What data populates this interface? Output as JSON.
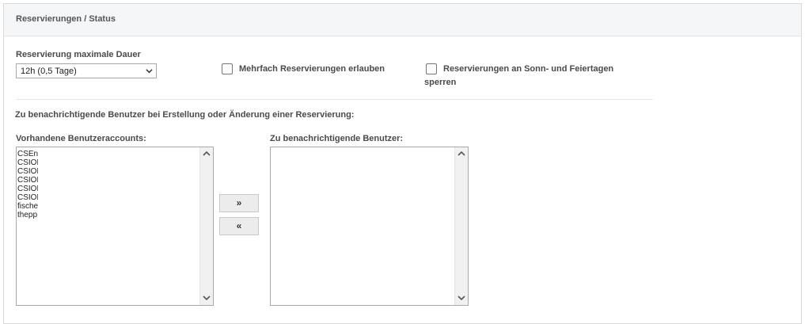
{
  "panel": {
    "title": "Reservierungen / Status"
  },
  "duration": {
    "label": "Reservierung maximale Dauer",
    "selected": "12h (0,5 Tage)"
  },
  "options": {
    "multiple_label": "Mehrfach Reservierungen erlauben",
    "holidays_label_line1": "Reservierungen an Sonn- und Feiertagen",
    "holidays_label_line2": "sperren"
  },
  "notify": {
    "heading": "Zu benachrichtigende Benutzer bei Erstellung oder Änderung einer Reservierung:",
    "available_label": "Vorhandene Benutzeraccounts:",
    "selected_label": "Zu benachrichtigende Benutzer:",
    "available_users": [
      "CSEnt",
      "CSIOE",
      "CSIOE",
      "CSIOE",
      "CSIOE",
      "CSIOE",
      "fische",
      "thepp"
    ],
    "selected_users": [],
    "add_label": "»",
    "remove_label": "«"
  }
}
